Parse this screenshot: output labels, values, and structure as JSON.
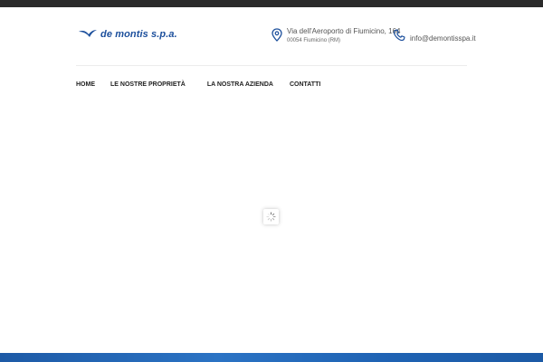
{
  "colors": {
    "topbar": "#2b2b2b",
    "brand_blue": "#1c4f9c",
    "footer_blue": "#2268b8"
  },
  "header": {
    "logo": {
      "text": "de montis s.p.a.",
      "icon": "seagull-logo-icon"
    },
    "address": {
      "icon": "map-pin-icon",
      "line1": "Via dell'Aeroporto di Fiumicino, 164",
      "line2": "00054 Fiumicino (RM)"
    },
    "email": {
      "icon": "phone-icon",
      "text": "info@demontisspa.it"
    }
  },
  "nav": {
    "items": [
      {
        "label": "HOME"
      },
      {
        "label": "LE NOSTRE PROPRIETÀ"
      },
      {
        "label": "LA NOSTRA AZIENDA"
      },
      {
        "label": "CONTATTI"
      }
    ]
  },
  "loader": {
    "icon": "loading-spinner-icon"
  }
}
